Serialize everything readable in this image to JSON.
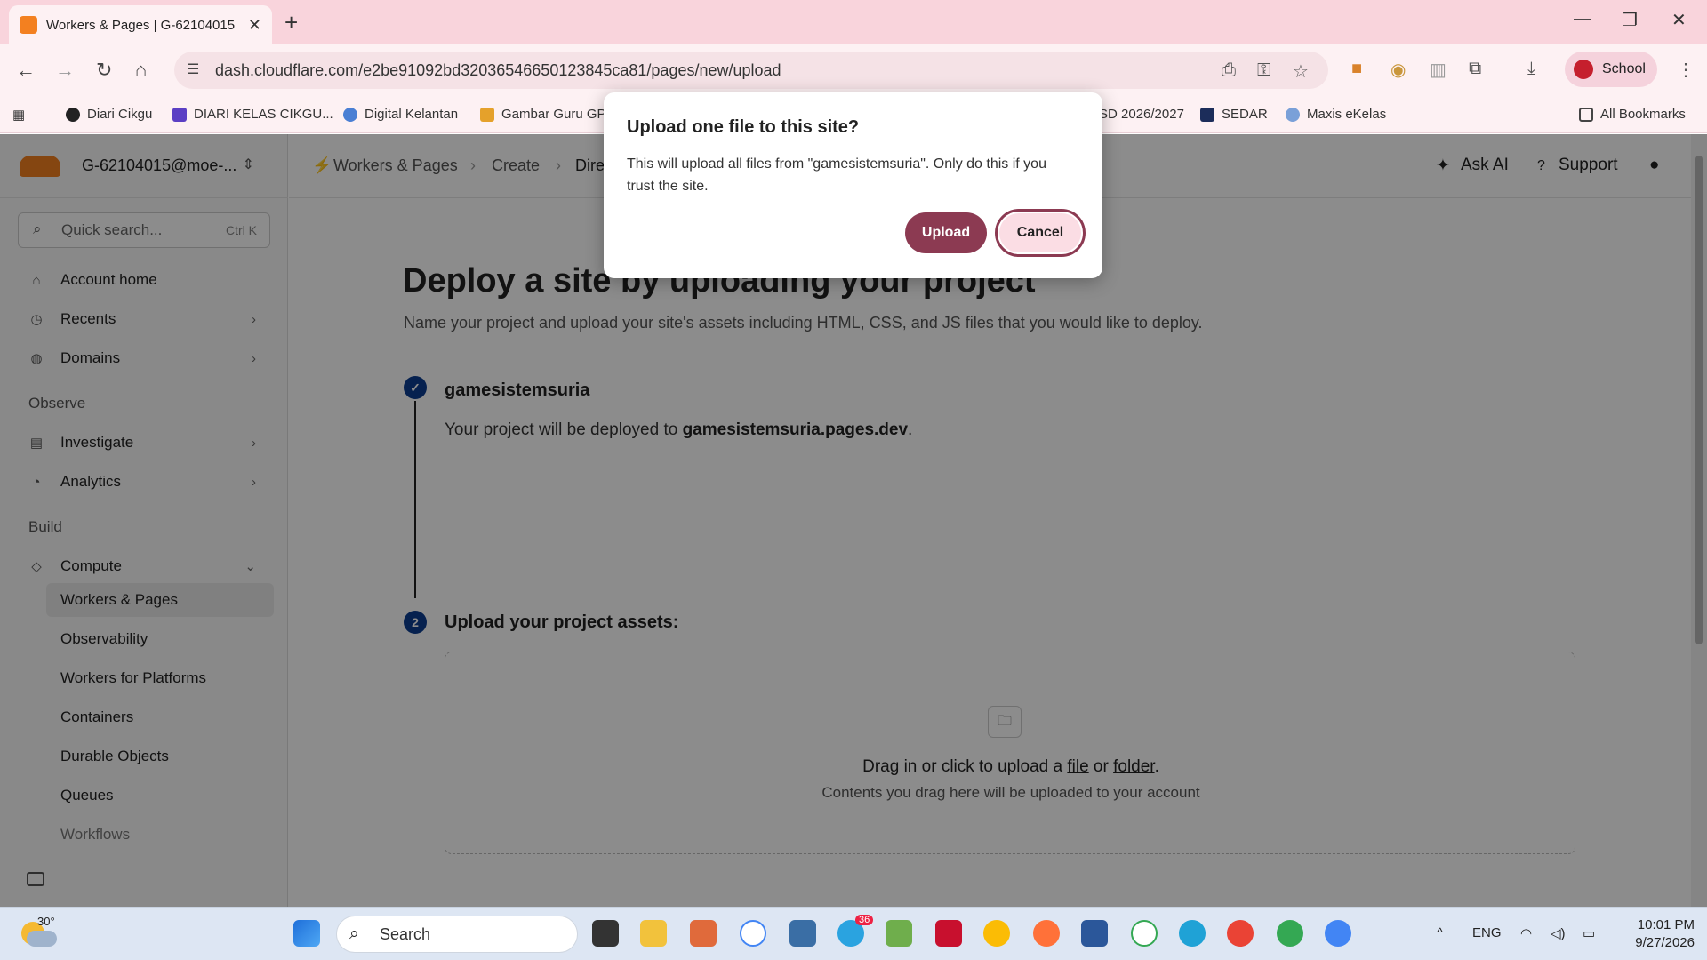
{
  "browser": {
    "tab_title": "Workers & Pages | G-62104015",
    "new_tab": "+",
    "url": "dash.cloudflare.com/e2be91092bd32036546650123845ca81/pages/new/upload",
    "profile": "School",
    "bookmarks": [
      "Diari Cikgu",
      "DIARI KELAS CIKGU...",
      "Digital Kelantan",
      "Gambar Guru GPI",
      "SD 2026/2027",
      "SEDAR",
      "Maxis eKelas",
      "All Bookmarks"
    ]
  },
  "sidebar": {
    "account": "G-62104015@moe-...",
    "search_placeholder": "Quick search...",
    "search_shortcut": "Ctrl K",
    "items": [
      {
        "label": "Account home"
      },
      {
        "label": "Recents"
      },
      {
        "label": "Domains"
      }
    ],
    "observe_label": "Observe",
    "observe_items": [
      {
        "label": "Investigate"
      },
      {
        "label": "Analytics"
      }
    ],
    "build_label": "Build",
    "compute_label": "Compute",
    "compute_items": [
      {
        "label": "Workers & Pages"
      },
      {
        "label": "Observability"
      },
      {
        "label": "Workers for Platforms"
      },
      {
        "label": "Containers"
      },
      {
        "label": "Durable Objects"
      },
      {
        "label": "Queues"
      },
      {
        "label": "Workflows"
      }
    ]
  },
  "header": {
    "crumbs": [
      "Workers & Pages",
      "Create",
      "Dire"
    ],
    "ask_ai": "Ask AI",
    "support": "Support"
  },
  "main": {
    "title": "Deploy a site by uploading your project",
    "subtitle": "Name your project and upload your site's assets including HTML, CSS, and JS files that you would like to deploy.",
    "project_name": "gamesistemsuria",
    "deploy_prefix": "Your project will be deployed to ",
    "deploy_domain": "gamesistemsuria.pages.dev",
    "deploy_suffix": ".",
    "step2_number": "2",
    "upload_title": "Upload your project assets:",
    "drag_prefix": "Drag in or click to upload a ",
    "drag_file": "file",
    "drag_or": " or ",
    "drag_folder": "folder",
    "drag_suffix": ".",
    "drag_sub": "Contents you drag here will be uploaded to your account"
  },
  "dialog": {
    "title": "Upload one file to this site?",
    "message": "This will upload all files from \"gamesistemsuria\". Only do this if you trust the site.",
    "upload": "Upload",
    "cancel": "Cancel"
  },
  "taskbar": {
    "temperature": "30°",
    "search": "Search",
    "lang": "ENG",
    "time": "10:01 PM",
    "date": "9/27/2026",
    "telegram_badge": "36"
  },
  "colors": {
    "accent": "#8c3a52",
    "step": "#0b3d91",
    "cloudflare": "#f38020"
  }
}
